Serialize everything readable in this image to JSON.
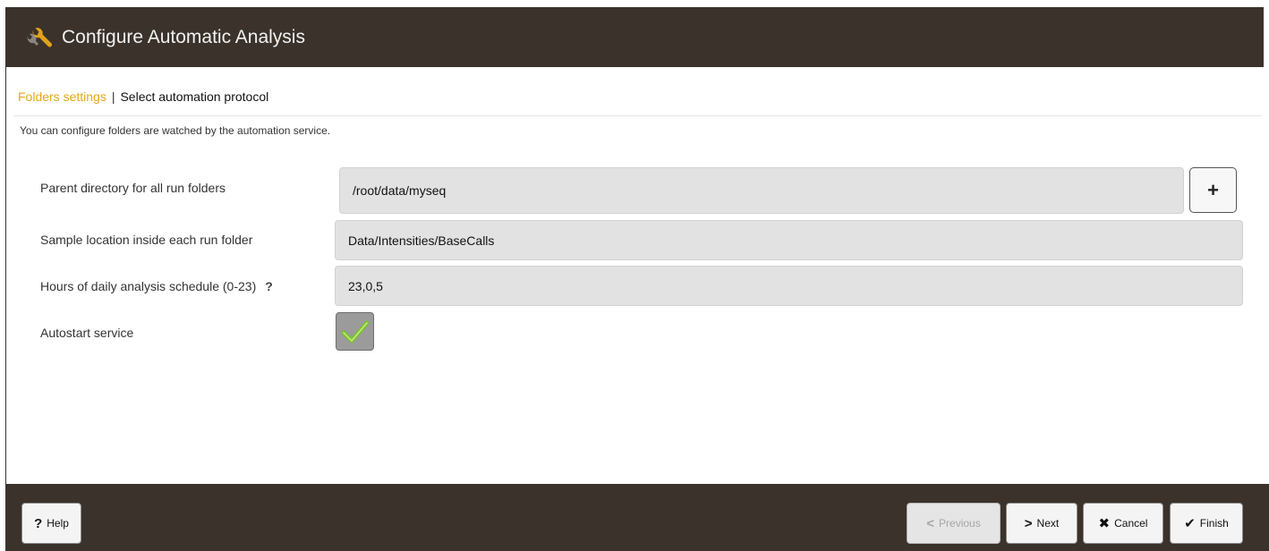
{
  "window": {
    "title": "Configure Automatic Analysis"
  },
  "breadcrumb": {
    "active": "Folders settings",
    "separator": "|",
    "current": "Select automation protocol"
  },
  "intro": "You can configure folders are watched by the automation service.",
  "form": {
    "parent_dir": {
      "label": "Parent directory for all run folders",
      "value": "/root/data/myseq",
      "add_button": "+"
    },
    "sample_location": {
      "label": "Sample location inside each run folder",
      "value": "Data/Intensities/BaseCalls"
    },
    "schedule": {
      "label": "Hours of daily analysis schedule (0-23)",
      "help": "?",
      "value": "23,0,5"
    },
    "autostart": {
      "label": "Autostart service",
      "checked": true
    }
  },
  "footer": {
    "help": "Help",
    "previous": "Previous",
    "next": "Next",
    "cancel": "Cancel",
    "finish": "Finish"
  },
  "colors": {
    "header_bg": "#3a322b",
    "accent": "#e2a814",
    "check_green": "#8fcf2e"
  },
  "icons": {
    "title": "wrench-icon",
    "help": "question-mark-icon",
    "previous": "chevron-left-icon",
    "next": "chevron-right-icon",
    "cancel": "close-icon",
    "finish": "checkmark-icon"
  }
}
